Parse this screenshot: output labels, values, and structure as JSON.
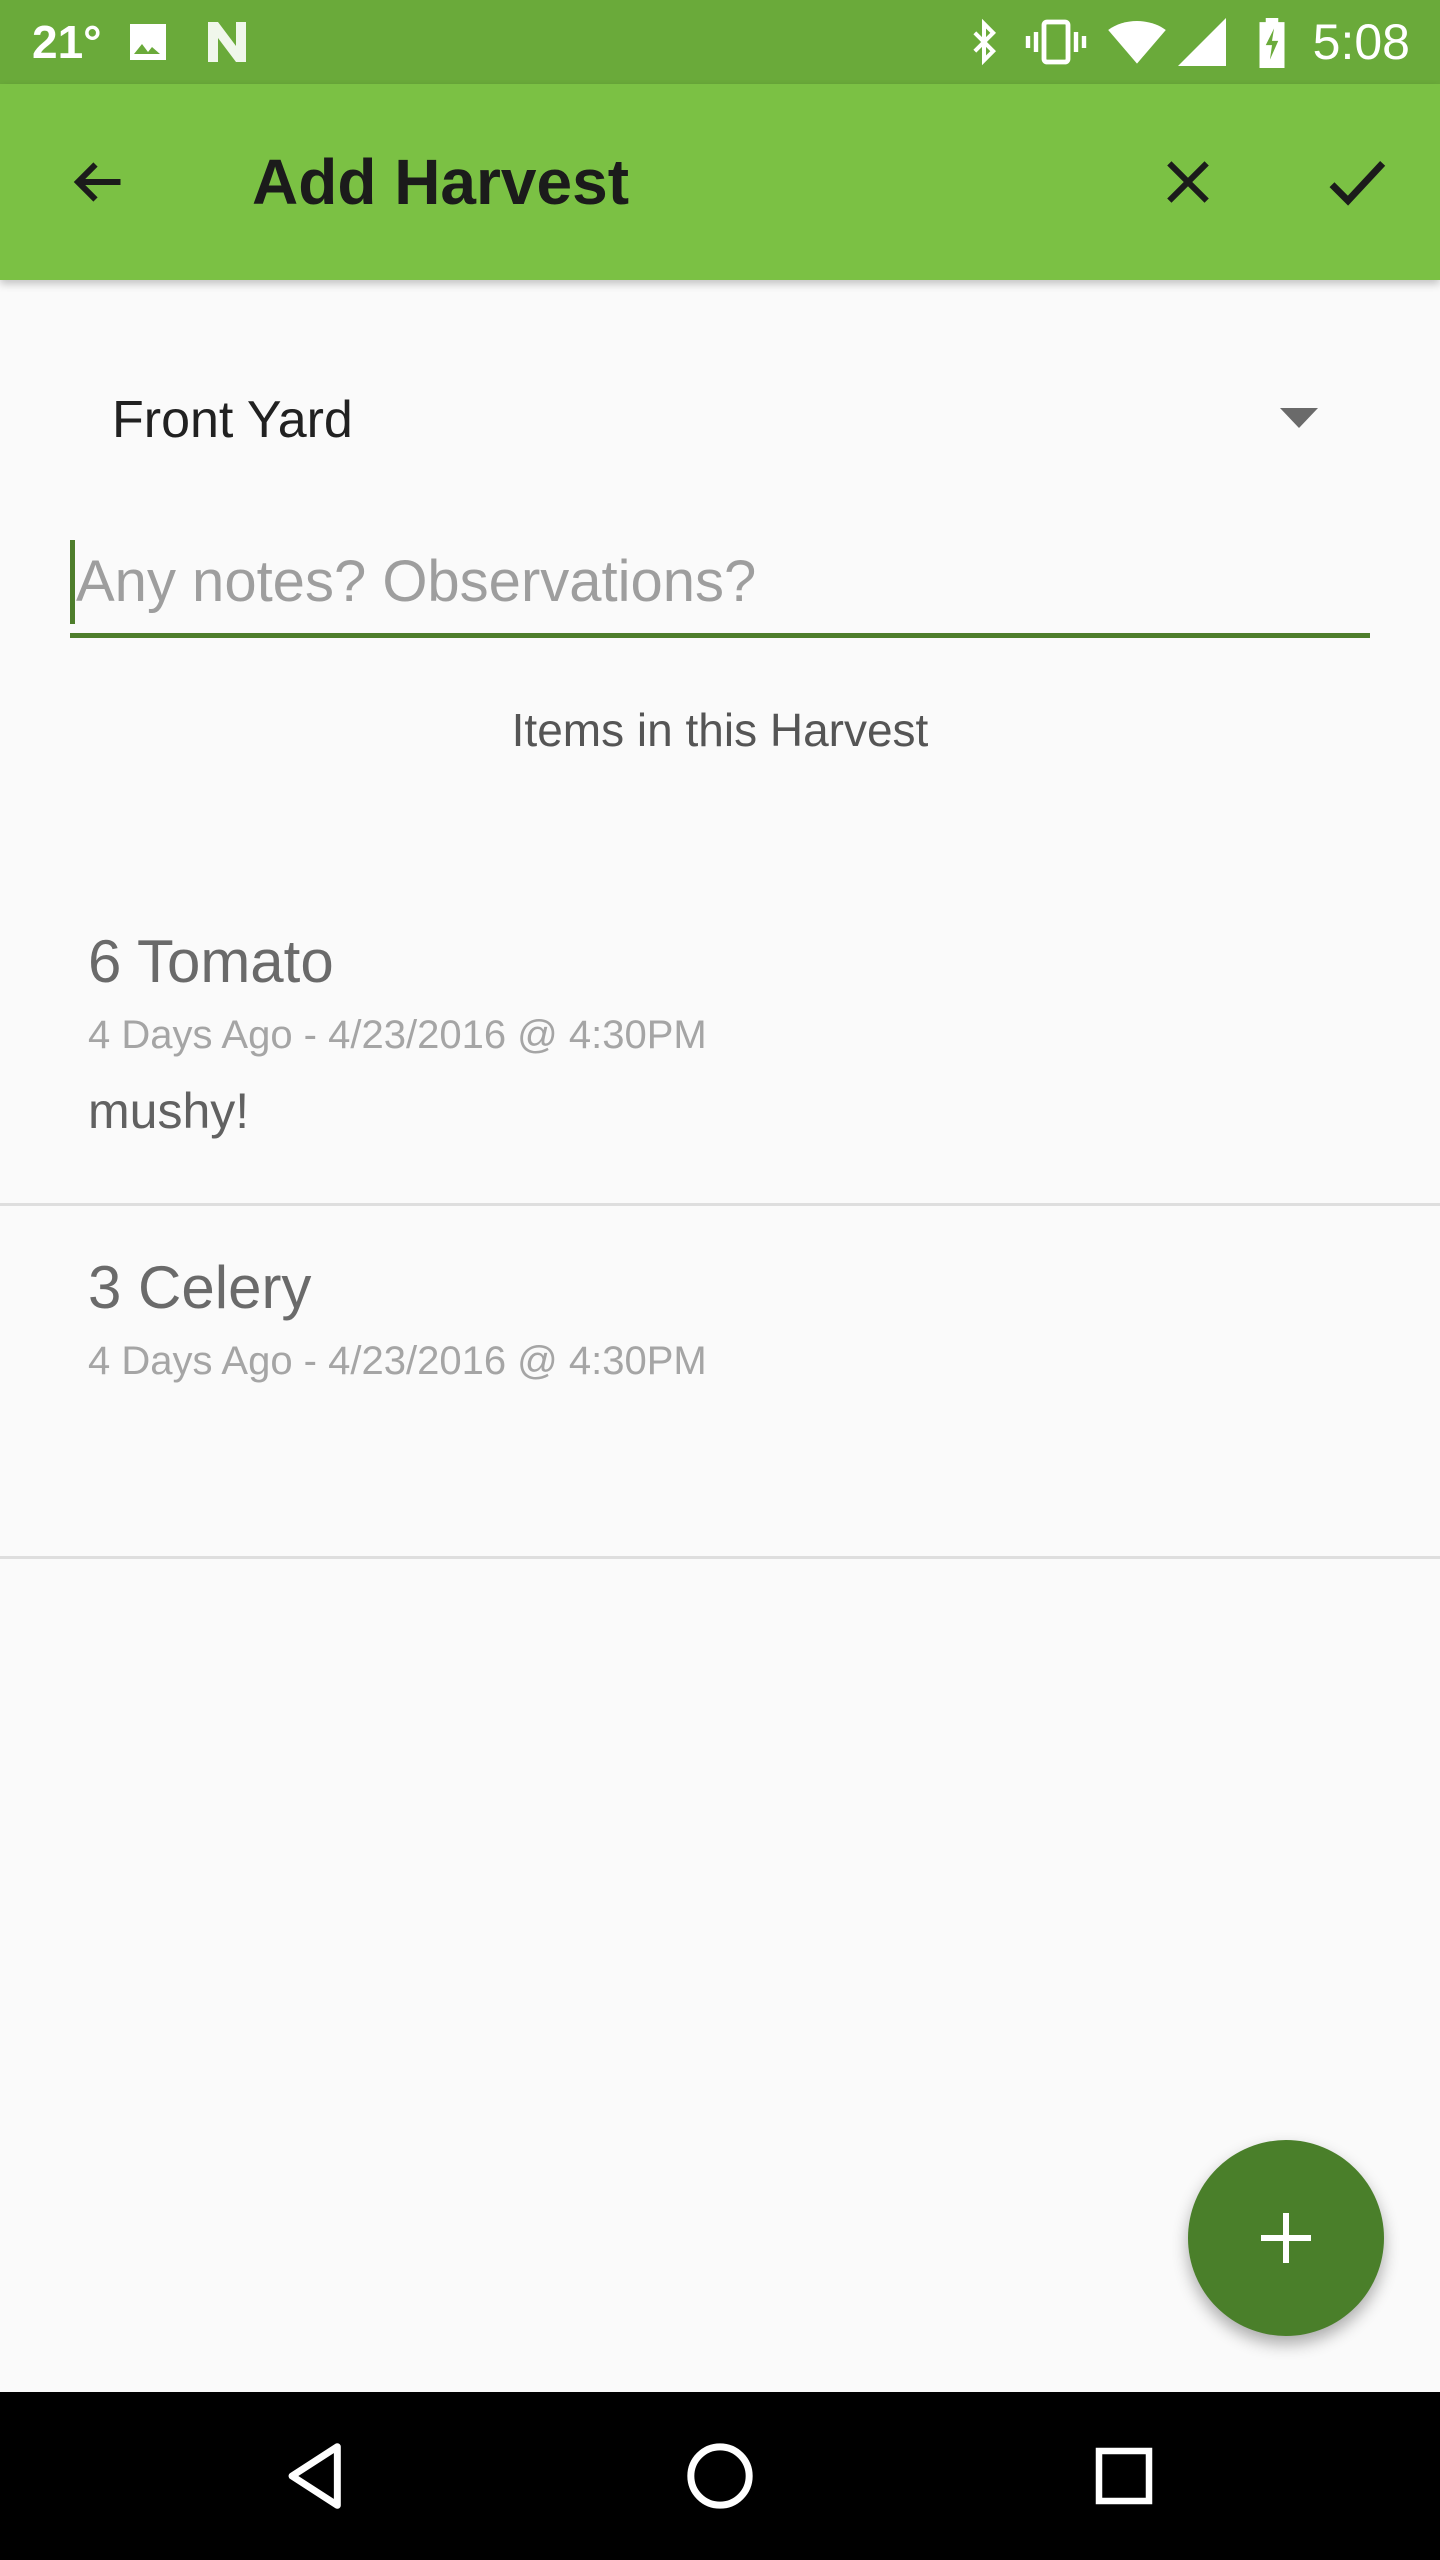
{
  "status_bar": {
    "temperature": "21°",
    "time": "5:08",
    "icons": [
      "image-icon",
      "n-notification-icon",
      "bluetooth-icon",
      "vibrate-icon",
      "wifi-icon",
      "cell-signal-icon",
      "battery-charging-icon"
    ]
  },
  "app_bar": {
    "title": "Add Harvest",
    "back_icon": "arrow-left-icon",
    "cancel_icon": "close-icon",
    "confirm_icon": "check-icon"
  },
  "location": {
    "selected": "Front Yard"
  },
  "notes": {
    "value": "",
    "placeholder": "Any notes? Observations?"
  },
  "items_label": "Items in this Harvest",
  "harvest_items": [
    {
      "name": "6 Tomato",
      "date": "4 Days Ago - 4/23/2016 @ 4:30PM",
      "note": "mushy!"
    },
    {
      "name": "3 Celery",
      "date": "4 Days Ago - 4/23/2016 @ 4:30PM",
      "note": ""
    }
  ],
  "fab": {
    "icon": "plus-icon"
  },
  "nav_bar": {
    "icons": [
      "back-triangle-icon",
      "home-circle-icon",
      "recents-square-icon"
    ]
  },
  "colors": {
    "status_bar": "#6aaa3a",
    "app_bar": "#7bc144",
    "accent": "#4e7e2c",
    "fab": "#4a7f2a"
  }
}
